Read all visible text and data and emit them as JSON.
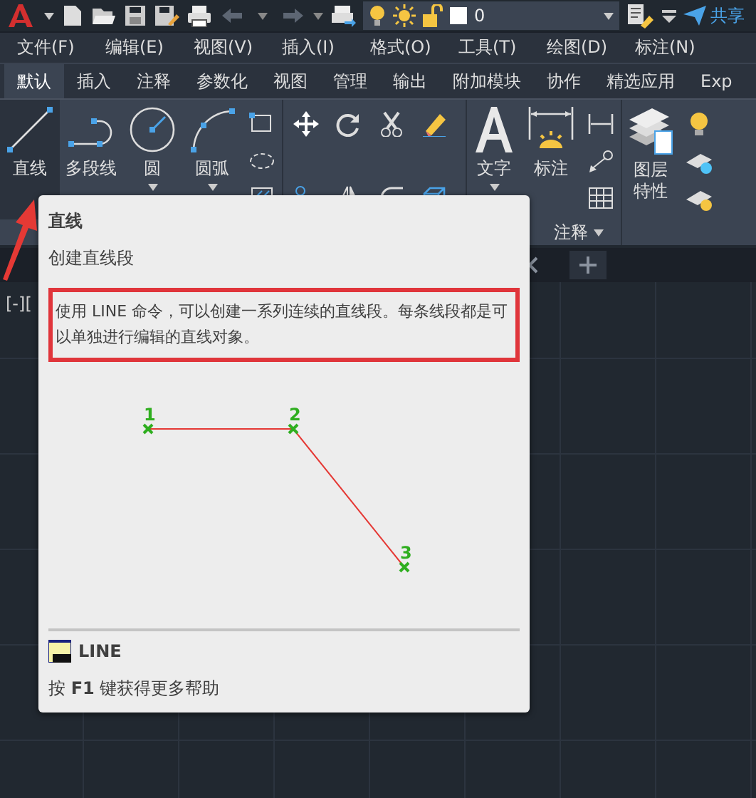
{
  "quick_access": {
    "layer_value": "0",
    "share_label": "共享"
  },
  "menu_bar": [
    "文件(F)",
    "编辑(E)",
    "视图(V)",
    "插入(I)",
    "格式(O)",
    "工具(T)",
    "绘图(D)",
    "标注(N)"
  ],
  "ribbon_tabs": [
    {
      "label": "默认",
      "selected": true
    },
    {
      "label": "插入",
      "selected": false
    },
    {
      "label": "注释",
      "selected": false
    },
    {
      "label": "参数化",
      "selected": false
    },
    {
      "label": "视图",
      "selected": false
    },
    {
      "label": "管理",
      "selected": false
    },
    {
      "label": "输出",
      "selected": false
    },
    {
      "label": "附加模块",
      "selected": false
    },
    {
      "label": "协作",
      "selected": false
    },
    {
      "label": "精选应用",
      "selected": false
    },
    {
      "label": "Exp",
      "selected": false
    }
  ],
  "draw_tools": [
    {
      "label": "直线",
      "selected": true,
      "dropdown": false,
      "kind": "line"
    },
    {
      "label": "多段线",
      "selected": false,
      "dropdown": false,
      "kind": "polyline"
    },
    {
      "label": "圆",
      "selected": false,
      "dropdown": true,
      "kind": "circle"
    },
    {
      "label": "圆弧",
      "selected": false,
      "dropdown": true,
      "kind": "arc"
    }
  ],
  "annotation_tools": [
    {
      "label": "文字",
      "dropdown": true,
      "kind": "text"
    },
    {
      "label": "标注",
      "dropdown": false,
      "kind": "dimension"
    }
  ],
  "annotation_panel_label": "注释",
  "layer_tool": {
    "label": "图层特性"
  },
  "canvas": {
    "viewport_label": "[-]["
  },
  "tooltip": {
    "title": "直线",
    "subtitle": "创建直线段",
    "description": "使用 LINE 命令，可以创建一系列连续的直线段。每条线段都是可以单独进行编辑的直线对象。",
    "diagram_points": [
      {
        "label": "1"
      },
      {
        "label": "2"
      },
      {
        "label": "3"
      }
    ],
    "command": "LINE",
    "help": "按 **F1** 键获得更多帮助"
  }
}
